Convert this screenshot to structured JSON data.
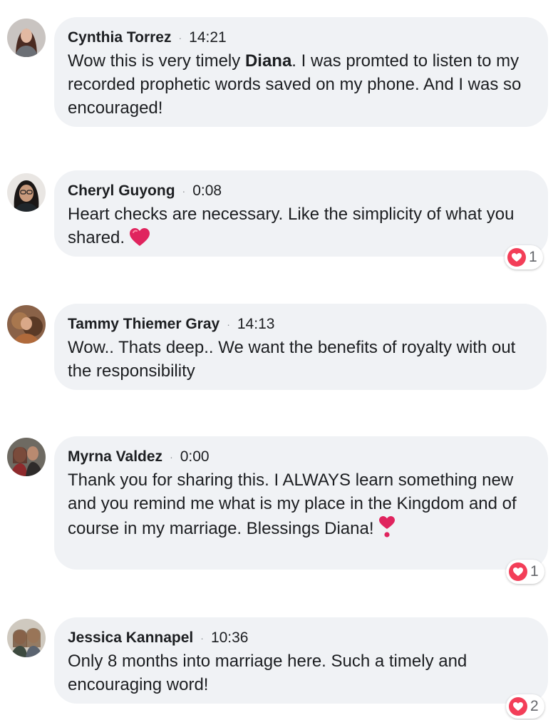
{
  "comments": [
    {
      "author": "Cynthia Torrez",
      "dot": "·",
      "time": "14:21",
      "text_before": "Wow this is very timely ",
      "mention": "Diana",
      "text_after": ". I was promted to listen to my recorded prophetic words saved on my phone. And I was so encouraged!"
    },
    {
      "author": "Cheryl Guyong",
      "dot": "·",
      "time": "0:08",
      "text": "Heart checks are necessary. Like the simplicity of what you shared.",
      "emoji": "red-heart-icon",
      "reaction_count": "1"
    },
    {
      "author": "Tammy Thiemer Gray",
      "dot": "·",
      "time": "14:13",
      "text": "Wow.. Thats deep.. We want the benefits of royalty with out the responsibility"
    },
    {
      "author": "Myrna Valdez",
      "dot": "·",
      "time": "0:00",
      "text": "Thank you for sharing this. I ALWAYS learn something new and you remind me what is my place in the Kingdom and of course in my marriage. Blessings Diana!",
      "emoji": "heart-exclamation-icon",
      "reaction_count": "1"
    },
    {
      "author": "Jessica Kannapel",
      "dot": "·",
      "time": "10:36",
      "text": "Only 8 months into marriage here. Such a timely and encouraging word!",
      "reaction_count": "2"
    }
  ],
  "colors": {
    "bubble": "#f0f2f5",
    "reaction_heart": "#f33e58",
    "meta_dot": "#8a8d91"
  }
}
